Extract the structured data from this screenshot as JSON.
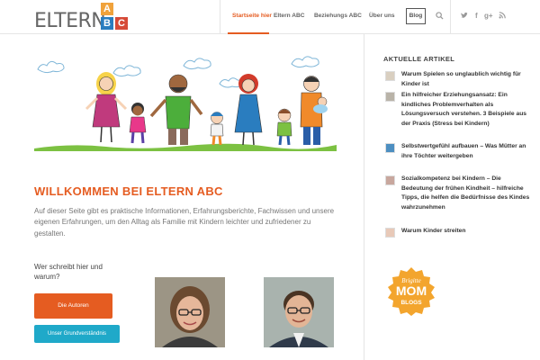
{
  "logo": {
    "text": "ELTERN",
    "blocks": [
      "A",
      "B",
      "C"
    ]
  },
  "nav": {
    "items": [
      "Startseite hier",
      "Eltern ABC",
      "Beziehungs ABC",
      "Über uns"
    ],
    "blog": "Blog"
  },
  "header_icons": [
    "search-icon",
    "twitter-icon",
    "facebook-icon",
    "google-plus-icon",
    "rss-icon"
  ],
  "hero": {
    "caption": "Eltern & Kinder spielen zusammen"
  },
  "welcome": {
    "title": "WILLKOMMEN BEI ELTERN ABC",
    "intro": "Auf dieser Seite gibt es praktische Informationen, Erfahrungsberichte, Fachwissen und unsere eigenen Erfahrungen, um den Alltag als Familie mit Kindern leichter und zufriedener zu gestalten."
  },
  "authors": {
    "question": "Wer schreibt hier und warum?",
    "btn_autoren": "Die Autoren",
    "btn_grund": "Unser Grundverständnis"
  },
  "sidebar": {
    "title": "AKTUELLE ARTIKEL",
    "articles": [
      {
        "title": "Warum Spielen so unglaublich wichtig für Kinder ist"
      },
      {
        "title": "Ein hilfreicher Erziehungsansatz: Ein kindliches Problemverhalten als Lösungsversuch verstehen. 3 Beispiele aus der Praxis (Stress bei Kindern)"
      },
      {
        "title": "Selbstwertgefühl aufbauen – Was Mütter an ihre Töchter weitergeben"
      },
      {
        "title": "Sozialkompetenz bei Kindern – Die Bedeutung der frühen Kindheit – hilfreiche Tipps, die helfen die Bedürfnisse des Kindes wahrzunehmen"
      },
      {
        "title": "Warum Kinder streiten"
      }
    ],
    "badge": {
      "top": "Brigitte",
      "mid": "MOM",
      "bottom": "BLOGS"
    }
  },
  "colors": {
    "accent": "#e55c21",
    "teal": "#1fa9c9",
    "badge": "#f3a52e"
  }
}
